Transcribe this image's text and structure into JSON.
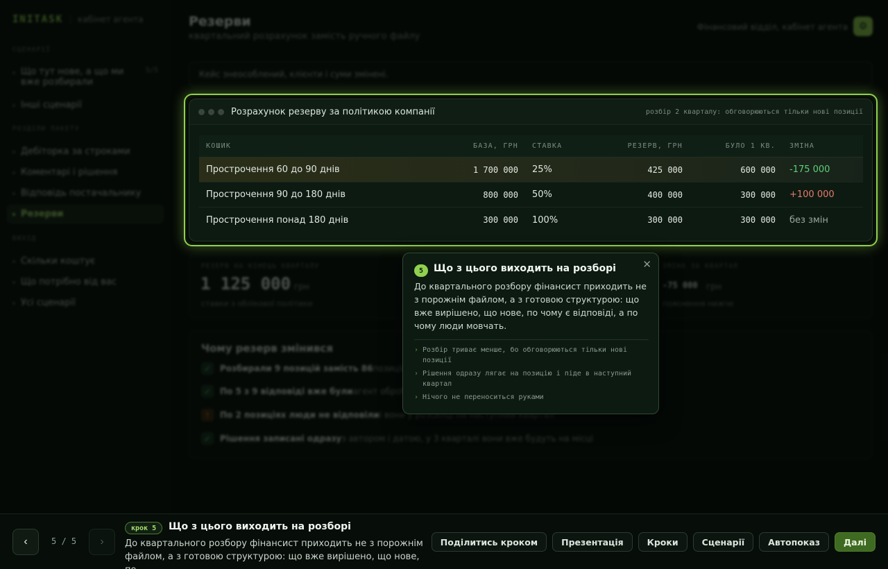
{
  "sidebar": {
    "brand": "INITASK",
    "brand_sub": "кабінет агента",
    "groups": [
      {
        "label": "СЦЕНАРІЇ",
        "items": [
          {
            "label": "Що тут нове, а що ми вже розбирали",
            "count": "5/5"
          },
          {
            "label": "Інші сценарії"
          }
        ]
      },
      {
        "label": "РОЗДІЛИ ПАКЕТУ",
        "items": [
          {
            "label": "Дебіторка за строками"
          },
          {
            "label": "Коментарі і рішення"
          },
          {
            "label": "Відповідь постачальнику"
          },
          {
            "label": "Резерви"
          }
        ]
      },
      {
        "label": "ВИХІД",
        "items": [
          {
            "label": "Скільки коштує"
          },
          {
            "label": "Що потрібно від вас"
          },
          {
            "label": "Усі сценарії"
          }
        ]
      }
    ]
  },
  "header": {
    "title": "Резерви",
    "subtitle": "квартальний розрахунок замість ручного файлу",
    "context": "Фінансовий відділ, кабінет агента"
  },
  "notice": "Кейс знеособлений, клієнти і суми змінені.",
  "table_card": {
    "title": "Розрахунок резерву за політикою компанії",
    "meta": "розбір 2 кварталу: обговорюються тільки нові позиції",
    "columns": [
      "КОШИК",
      "БАЗА, ГРН",
      "СТАВКА",
      "РЕЗЕРВ, ГРН",
      "БУЛО 1 КВ.",
      "ЗМІНА"
    ],
    "rows": [
      {
        "bucket": "Прострочення 60 до 90 днів",
        "base": "1 700 000",
        "rate": "25%",
        "reserve": "425 000",
        "prev": "600 000",
        "change": "-175 000",
        "change_type": "neg"
      },
      {
        "bucket": "Прострочення 90 до 180 днів",
        "base": "800 000",
        "rate": "50%",
        "reserve": "400 000",
        "prev": "300 000",
        "change": "+100 000",
        "change_type": "pos"
      },
      {
        "bucket": "Прострочення понад 180 днів",
        "base": "300 000",
        "rate": "100%",
        "reserve": "300 000",
        "prev": "300 000",
        "change": "без змін",
        "change_type": "none"
      }
    ]
  },
  "stats": {
    "left": {
      "label": "РЕЗЕРВ НА КІНЕЦЬ КВАРТАЛУ",
      "value": "1 125 000",
      "unit": "грн",
      "note": "ставки з облікової політики"
    },
    "right": {
      "label": "ЗМІНА ЗА КВАРТАЛ",
      "value": "-75 000",
      "unit": "грн",
      "note": "пояснення нижче"
    }
  },
  "why": {
    "title": "Чому резерв змінився",
    "rows": [
      {
        "strong": "Розбирали 9 позицій замість 86",
        "rest": " позицій",
        "icon": "check"
      },
      {
        "strong": "По 5 з 9 відповіді вже були",
        "rest": " агент обробив",
        "icon": "check"
      },
      {
        "strong": "По 2 позиціях люди не відповіли",
        "rest": " і вони у розсилці на наступний квартал",
        "icon": "warn"
      },
      {
        "strong": "Рішення записані одразу",
        "rest": " з автором і датою, у 3 кварталі вони вже будуть на місці",
        "icon": "check"
      }
    ]
  },
  "popover": {
    "step_number": "5",
    "title": "Що з цього виходить на розборі",
    "body": "До квартального розбору фінансист приходить не з порожнім файлом, а з готовою структурою: що вже вирішено, що нове, по чому є відповіді, а по чому люди мовчать.",
    "bullets": [
      "Розбір триває менше, бо обговорюються тільки нові позиції",
      "Рішення одразу лягає на позицію і піде в наступний квартал",
      "Нічого не переноситься руками"
    ]
  },
  "bottom_bar": {
    "pager": "5 / 5",
    "chip": "крок 5",
    "step_title": "Що з цього виходить на розборі",
    "step_desc": "До квартального розбору фінансист приходить не з порожнім файлом, а з готовою структурою: що вже вирішено, що нове, по…",
    "actions": [
      "Поділитись кроком",
      "Презентація",
      "Кроки",
      "Сценарії",
      "Автопоказ",
      "Далі"
    ]
  },
  "colors": {
    "accent": "#8fd14f",
    "negative_change": "#5cd07a",
    "positive_change": "#e77a6a",
    "background": "#070d09"
  }
}
